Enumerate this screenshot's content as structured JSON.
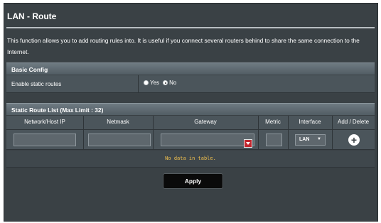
{
  "page": {
    "title": "LAN - Route",
    "description": "This function allows you to add routing rules into. It is useful if you connect several routers behind to share the same connection to the Internet."
  },
  "basic_config": {
    "header": "Basic Config",
    "enable_label": "Enable static routes",
    "options": [
      {
        "label": "Yes",
        "selected": false
      },
      {
        "label": "No",
        "selected": true
      }
    ]
  },
  "route_list": {
    "header": "Static Route List (Max Limit : 32)",
    "columns": [
      "Network/Host IP",
      "Netmask",
      "Gateway",
      "Metric",
      "Interface",
      "Add / Delete"
    ],
    "interface_value": "LAN",
    "interface_arrow": "▼",
    "add_symbol": "+",
    "empty_message": "No data in table."
  },
  "apply_label": "Apply"
}
